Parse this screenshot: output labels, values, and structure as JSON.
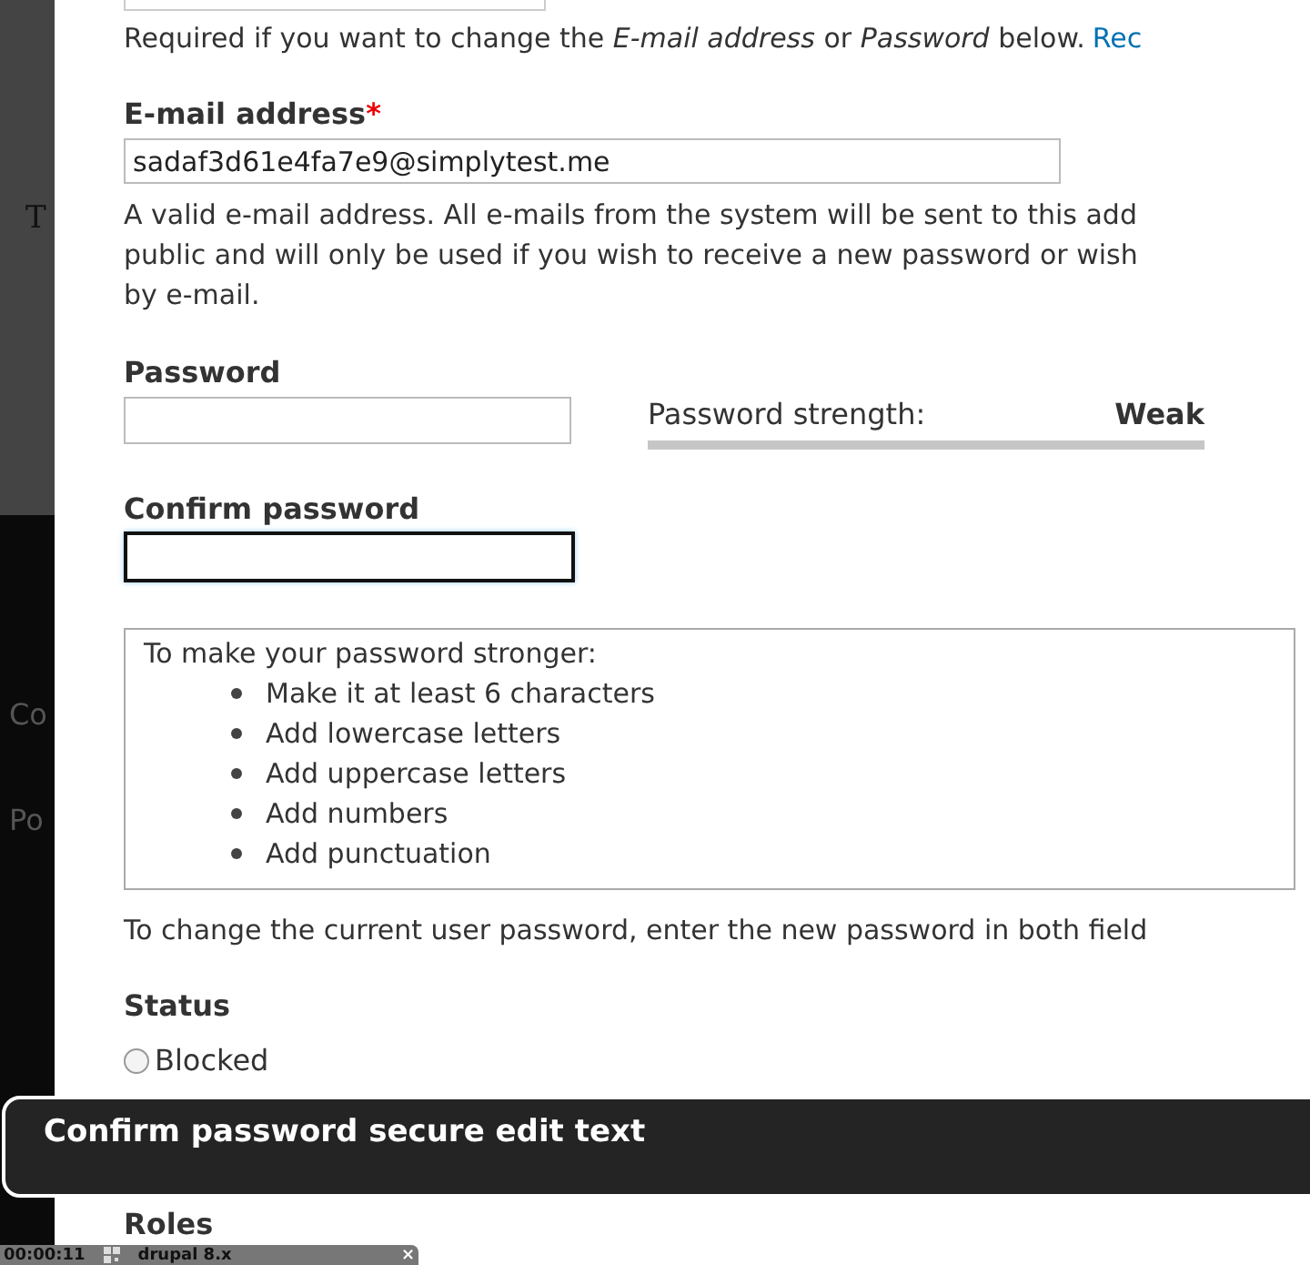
{
  "background_page": {
    "letter": "T",
    "items": [
      "Co",
      "Po"
    ]
  },
  "current_password_hint": {
    "text": "Required if you want to change the *E-mail address* or *Password* below.",
    "link": "Rec"
  },
  "email": {
    "label": "E-mail address",
    "required_mark": "*",
    "value": "sadaf3d61e4fa7e9@simplytest.me",
    "description": [
      "A valid e-mail address. All e-mails from the system will be sent to this add",
      "public and will only be used if you wish to receive a new password or wish",
      "by e-mail."
    ]
  },
  "password": {
    "label": "Password",
    "strength_label": "Password strength:",
    "strength_value": "Weak"
  },
  "confirm_password": {
    "label": "Confirm password",
    "focused": true
  },
  "suggestions": {
    "title": "To make your password stronger:",
    "items": [
      "Make it at least 6 characters",
      "Add lowercase letters",
      "Add uppercase letters",
      "Add numbers",
      "Add punctuation"
    ]
  },
  "change_hint": "To change the current user password, enter the new password in both field",
  "status": {
    "label": "Status",
    "options": [
      {
        "label": "Blocked",
        "selected": false
      }
    ]
  },
  "voiceover_caption": "Confirm password secure edit text",
  "roles_label": "Roles",
  "bottom_tab": {
    "time": "00:00:11",
    "title": "drupal 8.x",
    "close": "×"
  }
}
